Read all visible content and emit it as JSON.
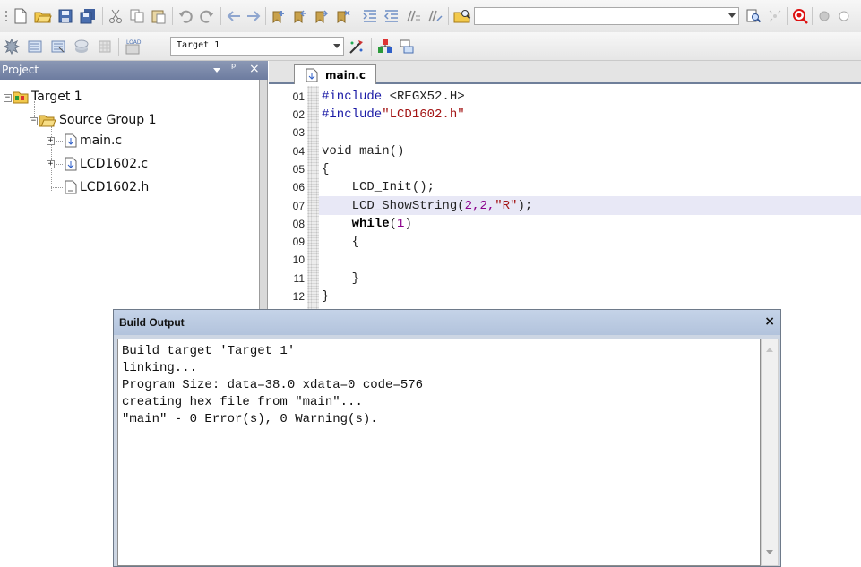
{
  "toolbar2": {
    "target_select": "Target 1"
  },
  "project_panel": {
    "title": "Project",
    "pin_glyph": "ᵖ",
    "close_glyph": "×",
    "tree": [
      {
        "label": "Target 1",
        "icon": "target-folder-icon"
      },
      {
        "label": "Source Group 1",
        "icon": "folder-open-icon"
      },
      {
        "label": "main.c",
        "icon": "c-file-icon"
      },
      {
        "label": "LCD1602.c",
        "icon": "c-file-icon"
      },
      {
        "label": "LCD1602.h",
        "icon": "header-file-icon"
      }
    ]
  },
  "editor": {
    "tab_label": "main.c",
    "line_numbers": [
      "01",
      "02",
      "03",
      "04",
      "05",
      "06",
      "07",
      "08",
      "09",
      "10",
      "11",
      "12"
    ],
    "code": {
      "l1_directive": "#include",
      "l1_rest": " <REGX52.H>",
      "l2_directive": "#include",
      "l2_string": "\"LCD1602.h\"",
      "l4": "void main()",
      "l5": "{",
      "l6": "    LCD_Init();",
      "l7_pre": "    LCD_ShowString(",
      "l7_args": "2,2,",
      "l7_string": "\"R\"",
      "l7_post": ");",
      "l8_keyword": "while",
      "l8_open": "(",
      "l8_num": "1",
      "l8_close": ")",
      "l9": "    {",
      "l11": "    }",
      "l12": "}"
    }
  },
  "build_output": {
    "title": "Build Output",
    "close_glyph": "×",
    "lines": [
      "Build target 'Target 1'",
      "linking...",
      "Program Size: data=38.0 xdata=0 code=576",
      "creating hex file from \"main\"...",
      "\"main\" - 0 Error(s), 0 Warning(s)."
    ]
  },
  "colors": {
    "directive": "#1a1aa6",
    "string": "#a31515",
    "number": "#8b008b",
    "highlight": "#e8e8f6",
    "panel_header": "#7888aa"
  }
}
